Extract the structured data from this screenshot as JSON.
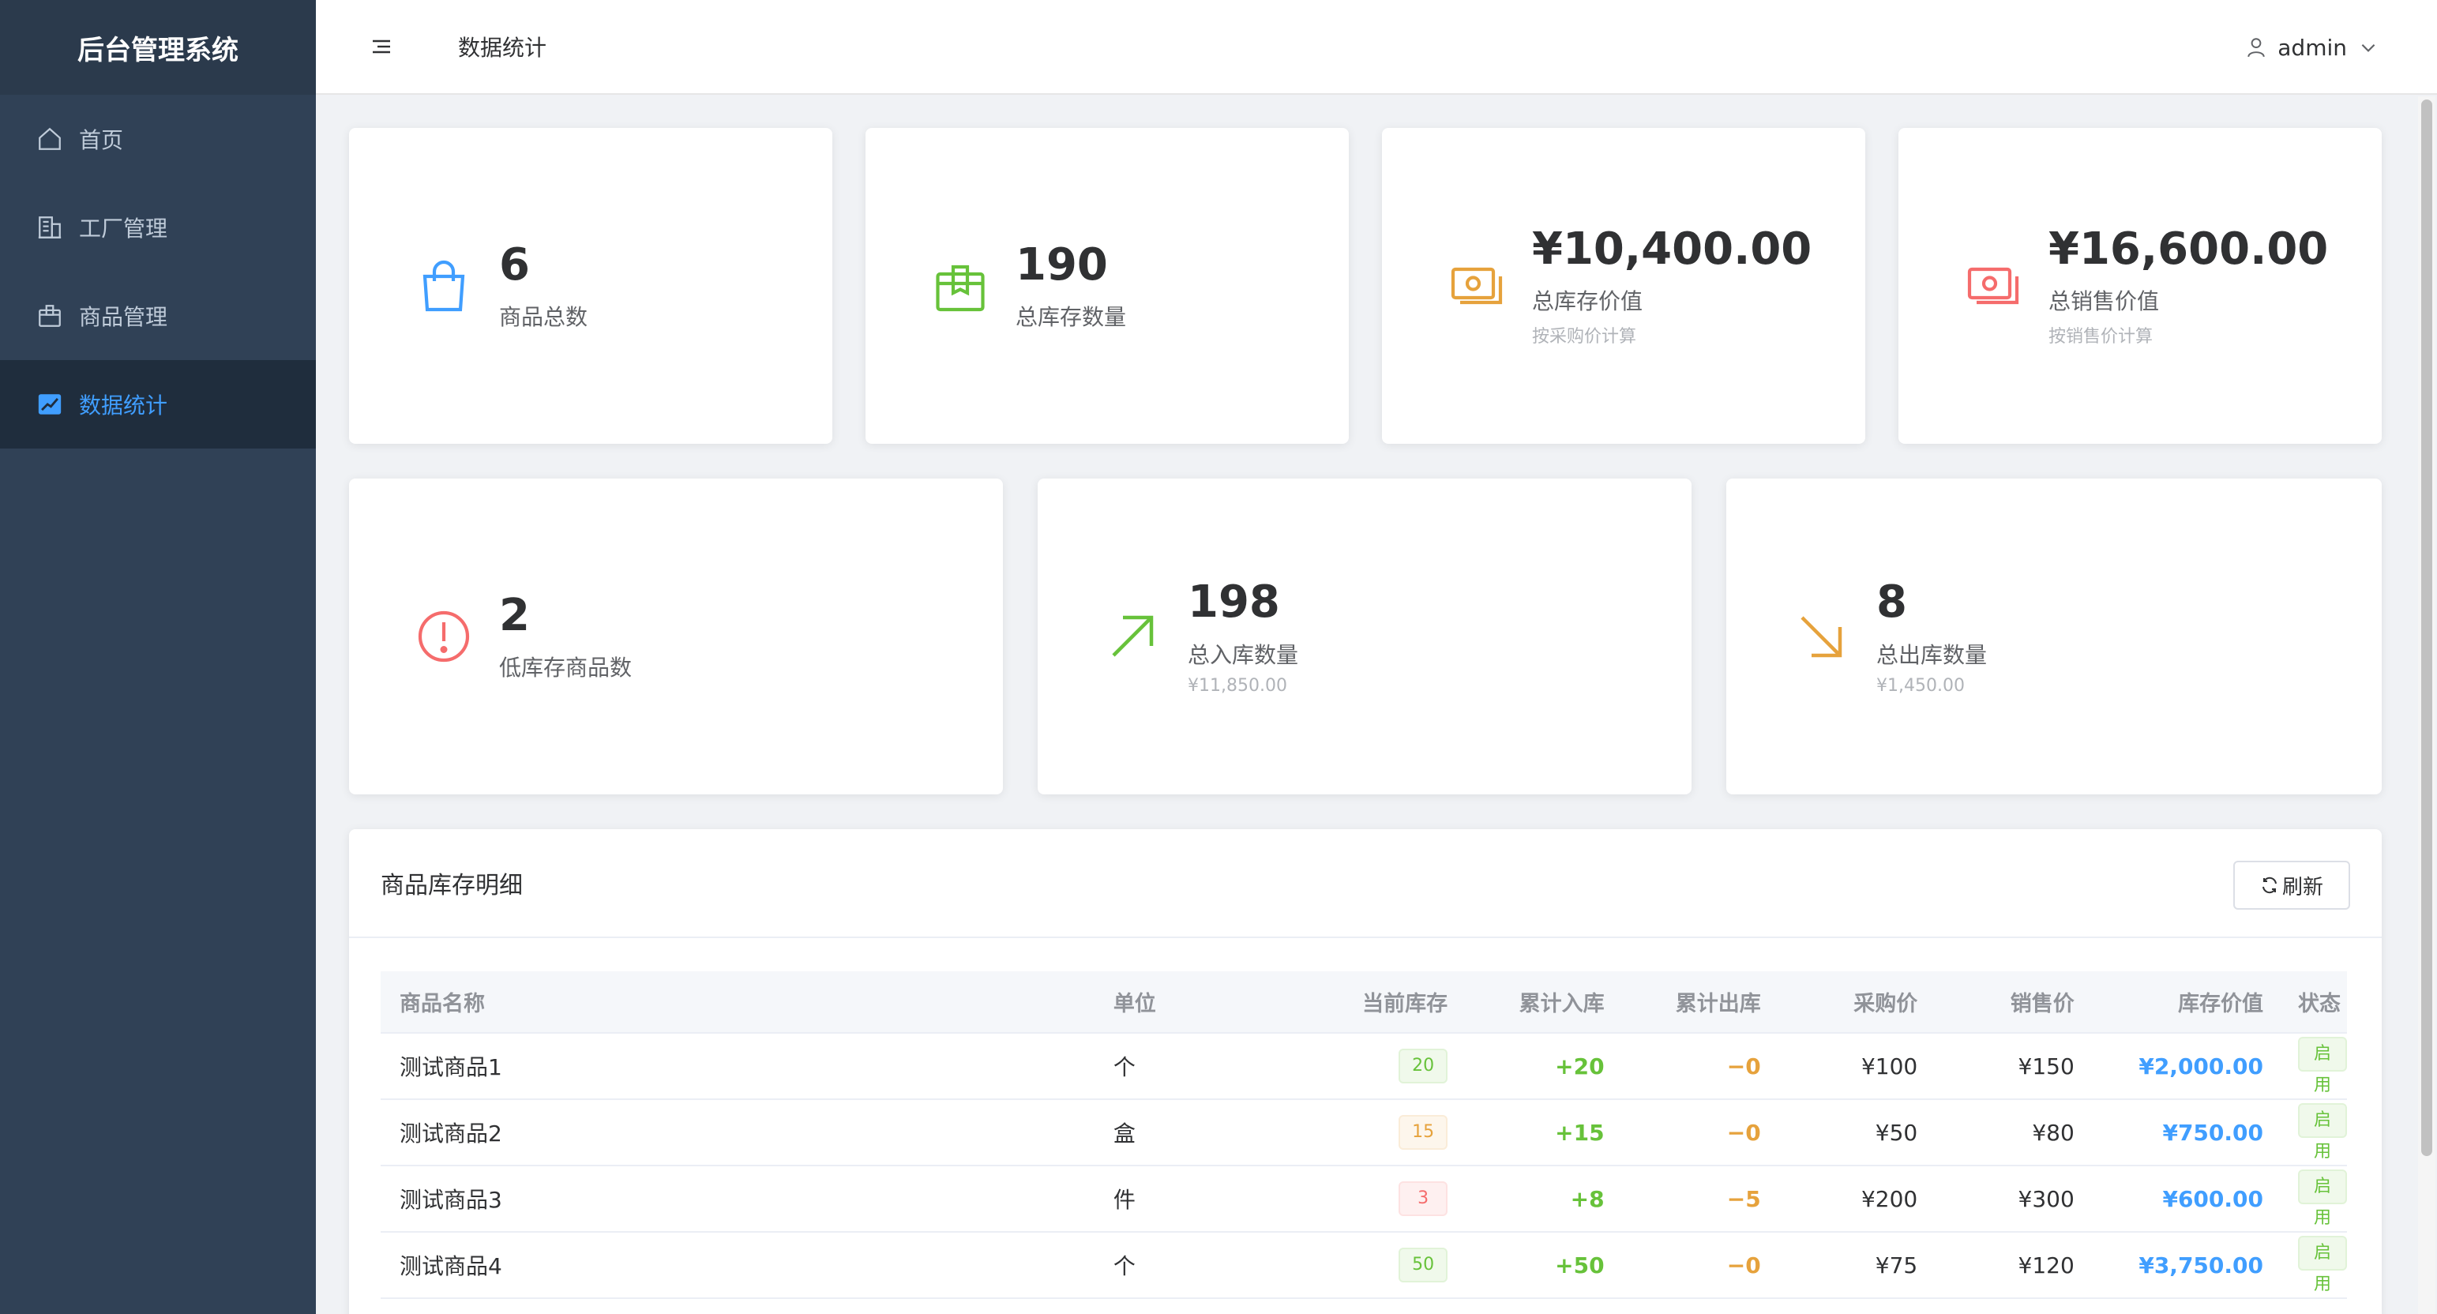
{
  "app": {
    "title": "后台管理系统"
  },
  "sidebar": {
    "items": [
      {
        "label": "首页",
        "icon": "home-icon"
      },
      {
        "label": "工厂管理",
        "icon": "building-icon"
      },
      {
        "label": "商品管理",
        "icon": "box-icon"
      },
      {
        "label": "数据统计",
        "icon": "chart-icon",
        "active": true
      }
    ]
  },
  "header": {
    "title": "数据统计",
    "user": "admin"
  },
  "stats_row1": [
    {
      "value": "6",
      "label": "商品总数",
      "sub": "",
      "icon": "shopping-bag-icon",
      "color": "#409eff"
    },
    {
      "value": "190",
      "label": "总库存数量",
      "sub": "",
      "icon": "package-icon",
      "color": "#67c23a"
    },
    {
      "value": "¥10,400.00",
      "label": "总库存价值",
      "sub": "按采购价计算",
      "icon": "money-icon",
      "color": "#e6a23c"
    },
    {
      "value": "¥16,600.00",
      "label": "总销售价值",
      "sub": "按销售价计算",
      "icon": "money-icon",
      "color": "#f56c6c"
    }
  ],
  "stats_row2": [
    {
      "value": "2",
      "label": "低库存商品数",
      "sub": "",
      "icon": "warning-icon",
      "color": "#f56c6c"
    },
    {
      "value": "198",
      "label": "总入库数量",
      "sub": "¥11,850.00",
      "icon": "arrow-up-right-icon",
      "color": "#67c23a"
    },
    {
      "value": "8",
      "label": "总出库数量",
      "sub": "¥1,450.00",
      "icon": "arrow-down-right-icon",
      "color": "#e6a23c"
    }
  ],
  "inventory": {
    "title": "商品库存明细",
    "refresh_label": "刷新",
    "columns": [
      "商品名称",
      "单位",
      "当前库存",
      "累计入库",
      "累计出库",
      "采购价",
      "销售价",
      "库存价值",
      "状态"
    ],
    "rows": [
      {
        "name": "测试商品1",
        "unit": "个",
        "stock": "20",
        "stock_level": "green",
        "in": "+20",
        "out": "−0",
        "cost": "¥100",
        "price": "¥150",
        "value": "¥2,000.00",
        "status": "启用"
      },
      {
        "name": "测试商品2",
        "unit": "盒",
        "stock": "15",
        "stock_level": "orange",
        "in": "+15",
        "out": "−0",
        "cost": "¥50",
        "price": "¥80",
        "value": "¥750.00",
        "status": "启用"
      },
      {
        "name": "测试商品3",
        "unit": "件",
        "stock": "3",
        "stock_level": "red",
        "in": "+8",
        "out": "−5",
        "cost": "¥200",
        "price": "¥300",
        "value": "¥600.00",
        "status": "启用"
      },
      {
        "name": "测试商品4",
        "unit": "个",
        "stock": "50",
        "stock_level": "green",
        "in": "+50",
        "out": "−0",
        "cost": "¥75",
        "price": "¥120",
        "value": "¥3,750.00",
        "status": "启用"
      }
    ]
  }
}
